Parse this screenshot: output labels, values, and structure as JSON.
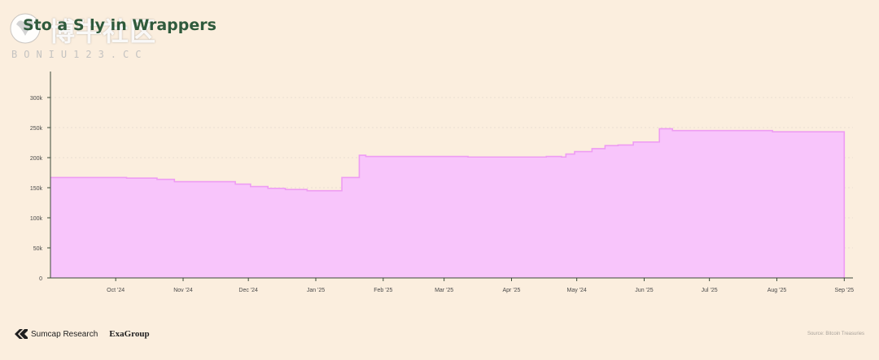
{
  "header": {
    "title": "Sto a   S ly in Wrappers"
  },
  "watermark": {
    "text": "博牛社区",
    "sub": "BONIU123.CC"
  },
  "footer": {
    "brand1": "Sumcap Research",
    "brand2": "ExaGroup",
    "source": "Source: Bitcoin Treasuries"
  },
  "colors": {
    "fill": "#f8c5fb",
    "line": "#ee9cf3",
    "axis": "#3b4a3a",
    "grid": "#d9d0c5",
    "text": "#4a4a4a"
  },
  "chart_data": {
    "type": "area",
    "title": "",
    "xlabel": "",
    "ylabel": "",
    "ylim": [
      0,
      300000
    ],
    "yticks": [
      0,
      50000,
      100000,
      150000,
      200000,
      250000,
      300000
    ],
    "ytick_labels": [
      "0",
      "50k",
      "100k",
      "150k",
      "200k",
      "250k",
      "300k"
    ],
    "xlim": [
      "2024-09-01",
      "2025-09-05"
    ],
    "xticks": [
      "2024-10-01",
      "2024-11-01",
      "2024-12-01",
      "2025-01-01",
      "2025-02-01",
      "2025-03-01",
      "2025-04-01",
      "2025-05-01",
      "2025-06-01",
      "2025-07-01",
      "2025-08-01",
      "2025-09-01"
    ],
    "xtick_labels": [
      "Oct '24",
      "Nov '24",
      "Dec '24",
      "Jan '25",
      "Feb '25",
      "Mar '25",
      "Apr '25",
      "May '24",
      "Jun '25",
      "Jul '25",
      "Aug '25",
      "Sep '25"
    ],
    "grid": true,
    "series": [
      {
        "points": [
          [
            "2024-09-01",
            167000
          ],
          [
            "2024-10-06",
            166000
          ],
          [
            "2024-10-20",
            164000
          ],
          [
            "2024-10-28",
            160000
          ],
          [
            "2024-11-25",
            156000
          ],
          [
            "2024-12-02",
            152000
          ],
          [
            "2024-12-10",
            149000
          ],
          [
            "2024-12-18",
            147000
          ],
          [
            "2024-12-28",
            145000
          ],
          [
            "2025-01-12",
            145000
          ],
          [
            "2025-01-13",
            167000
          ],
          [
            "2025-01-20",
            167000
          ],
          [
            "2025-01-21",
            204000
          ],
          [
            "2025-01-24",
            202000
          ],
          [
            "2025-03-12",
            201000
          ],
          [
            "2025-04-16",
            201000
          ],
          [
            "2025-04-17",
            202000
          ],
          [
            "2025-04-24",
            201000
          ],
          [
            "2025-04-26",
            206000
          ],
          [
            "2025-04-30",
            210000
          ],
          [
            "2025-05-08",
            215000
          ],
          [
            "2025-05-14",
            220000
          ],
          [
            "2025-05-20",
            221000
          ],
          [
            "2025-05-27",
            226000
          ],
          [
            "2025-06-07",
            226000
          ],
          [
            "2025-06-08",
            248000
          ],
          [
            "2025-06-14",
            245000
          ],
          [
            "2025-07-25",
            245000
          ],
          [
            "2025-07-30",
            243000
          ],
          [
            "2025-09-01",
            243000
          ]
        ]
      }
    ]
  }
}
